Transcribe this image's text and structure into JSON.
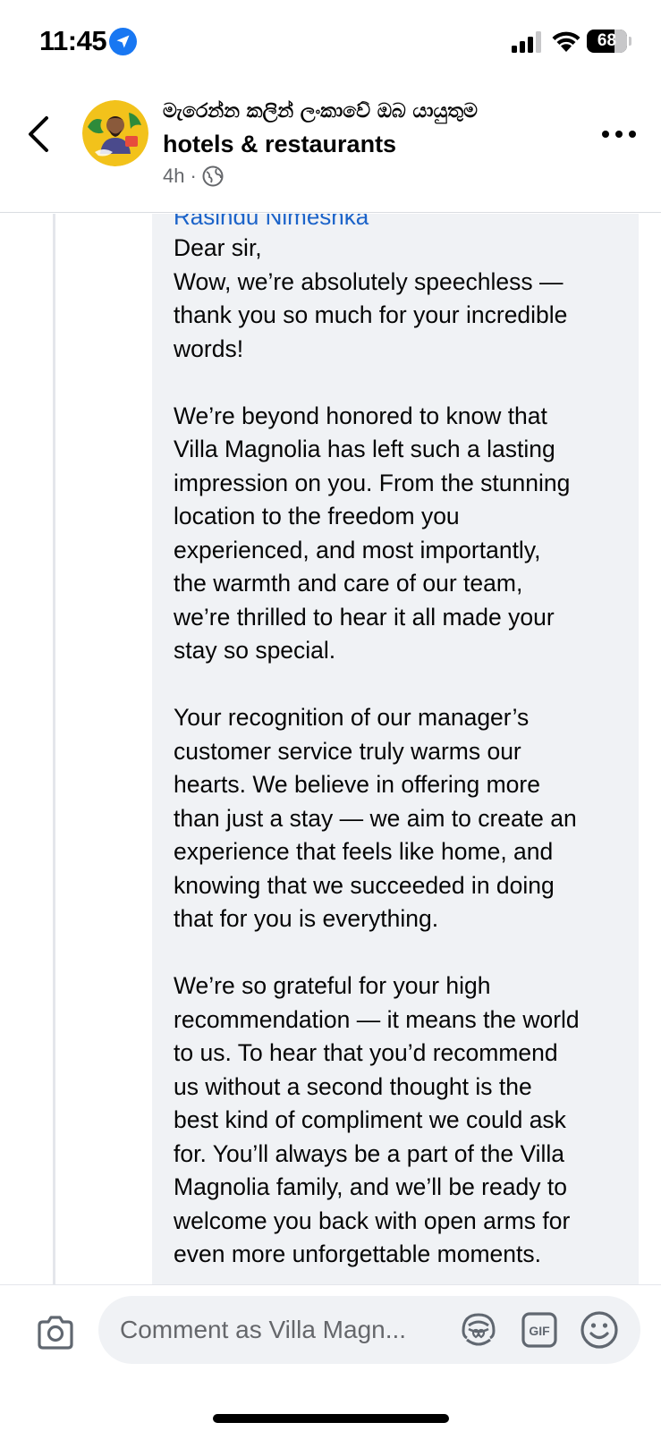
{
  "status_bar": {
    "time": "11:45",
    "battery": "68",
    "battery_level": 0.68,
    "icons": [
      "location-arrow-icon",
      "cellular-signal-icon",
      "wifi-icon",
      "battery-icon"
    ]
  },
  "header": {
    "title_line1": "මැරෙන්න කලින් ලංකාවේ ඔබ යායුතුම",
    "title_line2": "hotels & restaurants",
    "age": "4h",
    "dot": "·",
    "icons": [
      "back-chevron-icon",
      "globe-icon",
      "more-dots-icon"
    ]
  },
  "comment": {
    "author": "Rasindu Nimeshka",
    "lines": [
      "Dear sir,",
      "Wow, we’re absolutely speechless —",
      "thank you so much for your incredible",
      "words!",
      "",
      "We’re beyond honored to know that",
      "Villa Magnolia has left such a lasting",
      "impression on you. From the stunning",
      "location to the freedom you",
      "experienced, and most importantly,",
      "the warmth and care of our team,",
      "we’re thrilled to hear it all made your",
      "stay so special.",
      "",
      "Your recognition of our manager’s",
      "customer service truly warms our",
      "hearts. We believe in offering more",
      "than just a stay — we aim to create an",
      "experience that feels like home, and",
      "knowing that we succeeded in doing",
      "that for you is everything.",
      "",
      "We’re so grateful for your high",
      "recommendation — it means the world",
      "to us. To hear that you’d recommend",
      "us without a second thought is the",
      "best kind of compliment we could ask",
      "for. You’ll always be a part of the Villa",
      "Magnolia family, and we’ll be ready to",
      "welcome you back with open arms for",
      "even more unforgettable moments."
    ]
  },
  "composer": {
    "placeholder": "Comment as Villa Magn...",
    "gif_label": "GIF",
    "icons": [
      "camera-icon",
      "avatar-sticker-icon",
      "gif-icon",
      "emoji-icon"
    ]
  },
  "colors": {
    "author_link": "#1b63c9",
    "bubble_bg": "#f0f2f5",
    "location_badge": "#1877f2",
    "muted_text": "#65676b"
  }
}
